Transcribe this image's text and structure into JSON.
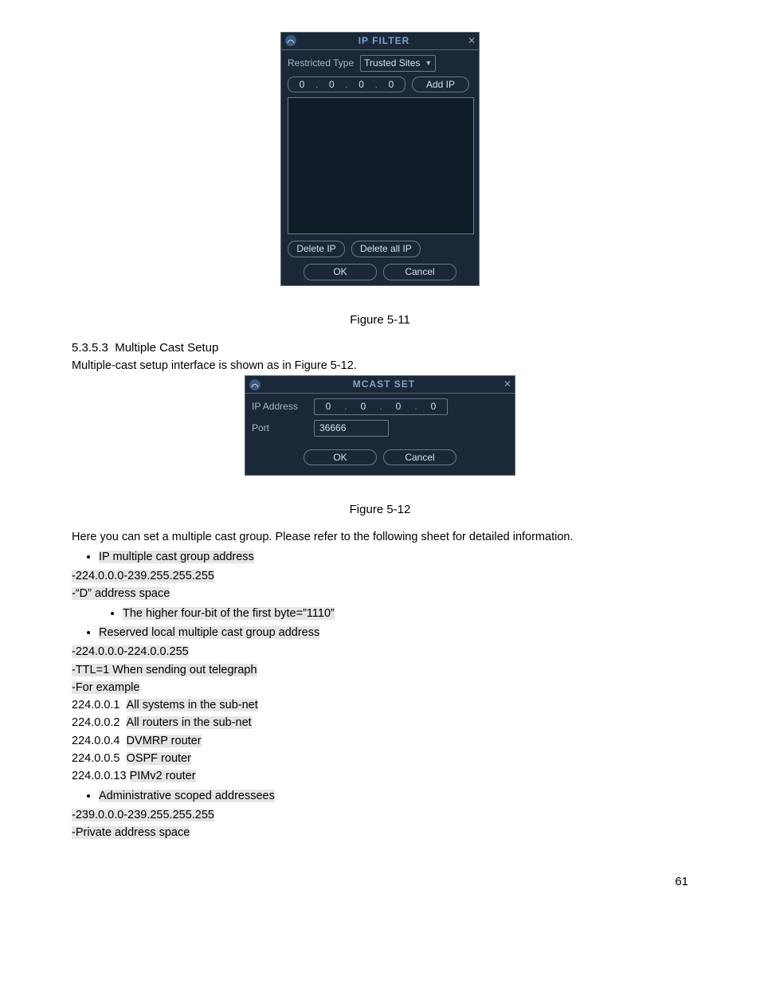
{
  "fig511": {
    "title": "IP FILTER",
    "restricted_label": "Restricted Type",
    "restricted_value": "Trusted Sites",
    "ip_octets": [
      "0",
      "0",
      "0",
      "0"
    ],
    "add_ip_btn": "Add IP",
    "delete_ip_btn": "Delete IP",
    "delete_all_btn": "Delete all IP",
    "ok_btn": "OK",
    "cancel_btn": "Cancel",
    "caption": "Figure 5-11"
  },
  "section": {
    "number": "5.3.5.3",
    "title": "Multiple Cast Setup",
    "intro": "Multiple-cast setup interface is shown as in Figure 5-12."
  },
  "fig512": {
    "title": "MCAST SET",
    "ip_label": "IP Address",
    "ip_octets": [
      "0",
      "0",
      "0",
      "0"
    ],
    "port_label": "Port",
    "port_value": "36666",
    "ok_btn": "OK",
    "cancel_btn": "Cancel",
    "caption": "Figure 5-12"
  },
  "text": {
    "para1": "Here you can set a multiple cast group. Please refer to the following sheet for detailed information.",
    "b1": "IP multiple cast group address",
    "l1": "-224.0.0.0-239.255.255.255",
    "l2": "-“D” address space",
    "b2": "The higher four-bit of the first byte=”1110”",
    "b3": "Reserved local multiple cast group address",
    "l3": "-224.0.0.0-224.0.0.255",
    "l4": "-TTL=1 When sending out telegraph",
    "l5": "-For example",
    "r1a": "224.0.0.1",
    "r1b": "All systems in the sub-net",
    "r2a": "224.0.0.2",
    "r2b": "All routers in the sub-net",
    "r3a": "224.0.0.4",
    "r3b": "DVMRP router",
    "r4a": "224.0.0.5",
    "r4b": "OSPF router",
    "r5a": "224.0.0.13",
    "r5b": "PIMv2 router",
    "b4": "Administrative scoped addressees",
    "l6": "-239.0.0.0-239.255.255.255",
    "l7": "-Private address space"
  },
  "page_number": "61"
}
